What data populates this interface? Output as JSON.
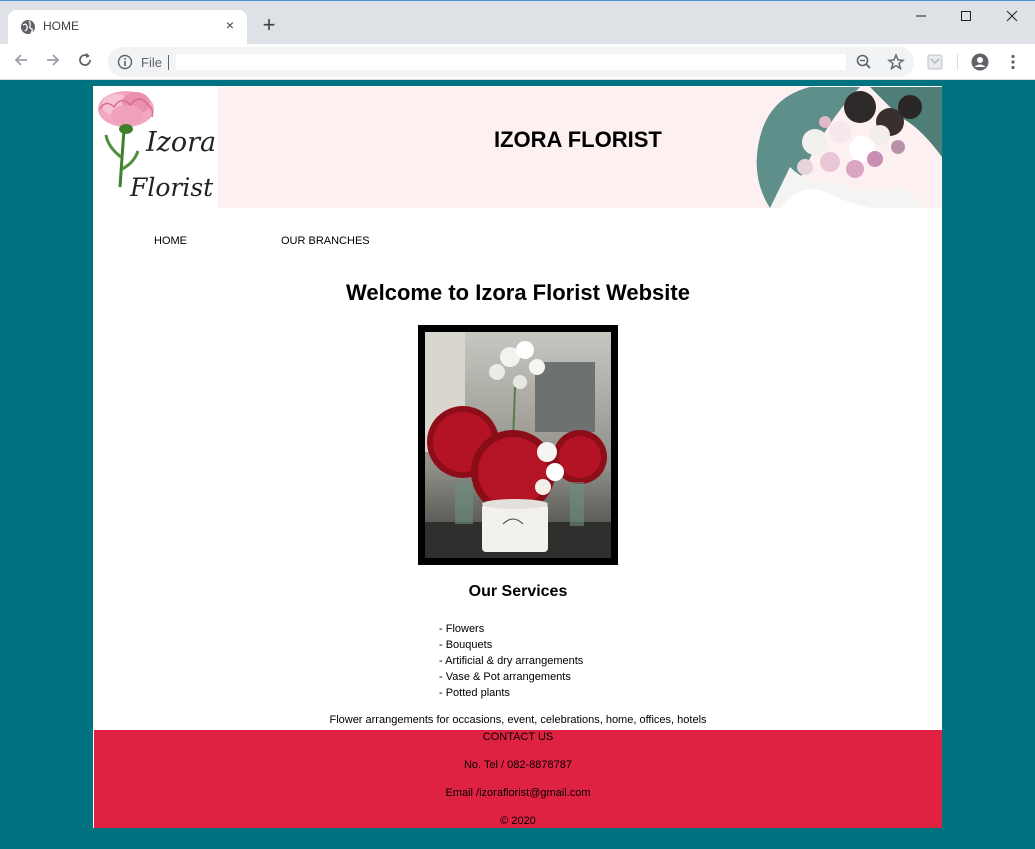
{
  "browser": {
    "tab_title": "HOME",
    "tab_close": "×",
    "new_tab": "+",
    "address_scheme": "File"
  },
  "header": {
    "logo_line1": "Izora",
    "logo_line2": "Florist",
    "title": "IZORA FLORIST"
  },
  "nav": {
    "items": [
      {
        "label": "HOME"
      },
      {
        "label": "OUR BRANCHES"
      }
    ]
  },
  "main": {
    "heading": "Welcome to Izora Florist Website",
    "services_title": "Our Services",
    "services": [
      "- Flowers",
      "- Bouquets",
      "- Artificial & dry arrangements",
      "- Vase & Pot arrangements",
      "- Potted plants"
    ],
    "tagline": "Flower arrangements for occasions, event, celebrations, home, offices, hotels"
  },
  "footer": {
    "contact_heading": "CONTACT US",
    "phone": "No. Tel / 082-8878787",
    "email": "Email /izoraflorist@gmail.com",
    "copyright": "© 2020"
  },
  "colors": {
    "page_background": "#01727f",
    "header_background": "#fcf0f1",
    "footer_background": "#df2241"
  }
}
